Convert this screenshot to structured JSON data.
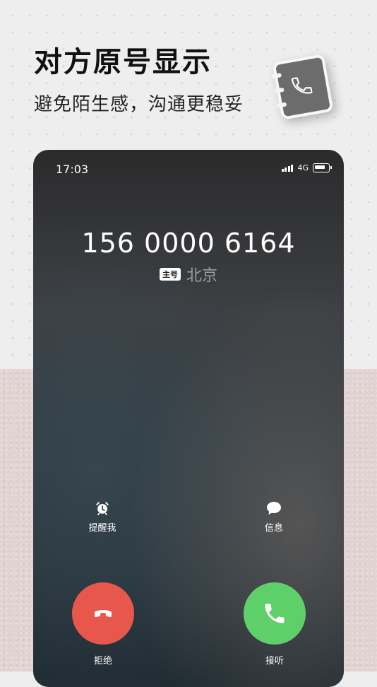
{
  "promo": {
    "headline": "对方原号显示",
    "subline": "避免陌生感，沟通更稳妥"
  },
  "status_bar": {
    "time": "17:03",
    "network": "4G"
  },
  "caller": {
    "number": "156 0000 6164",
    "badge": "主号",
    "location": "北京"
  },
  "actions": {
    "remind_label": "提醒我",
    "message_label": "信息"
  },
  "call_controls": {
    "decline_label": "拒绝",
    "accept_label": "接听",
    "decline_color": "#e8574c",
    "accept_color": "#5fcf6a"
  }
}
